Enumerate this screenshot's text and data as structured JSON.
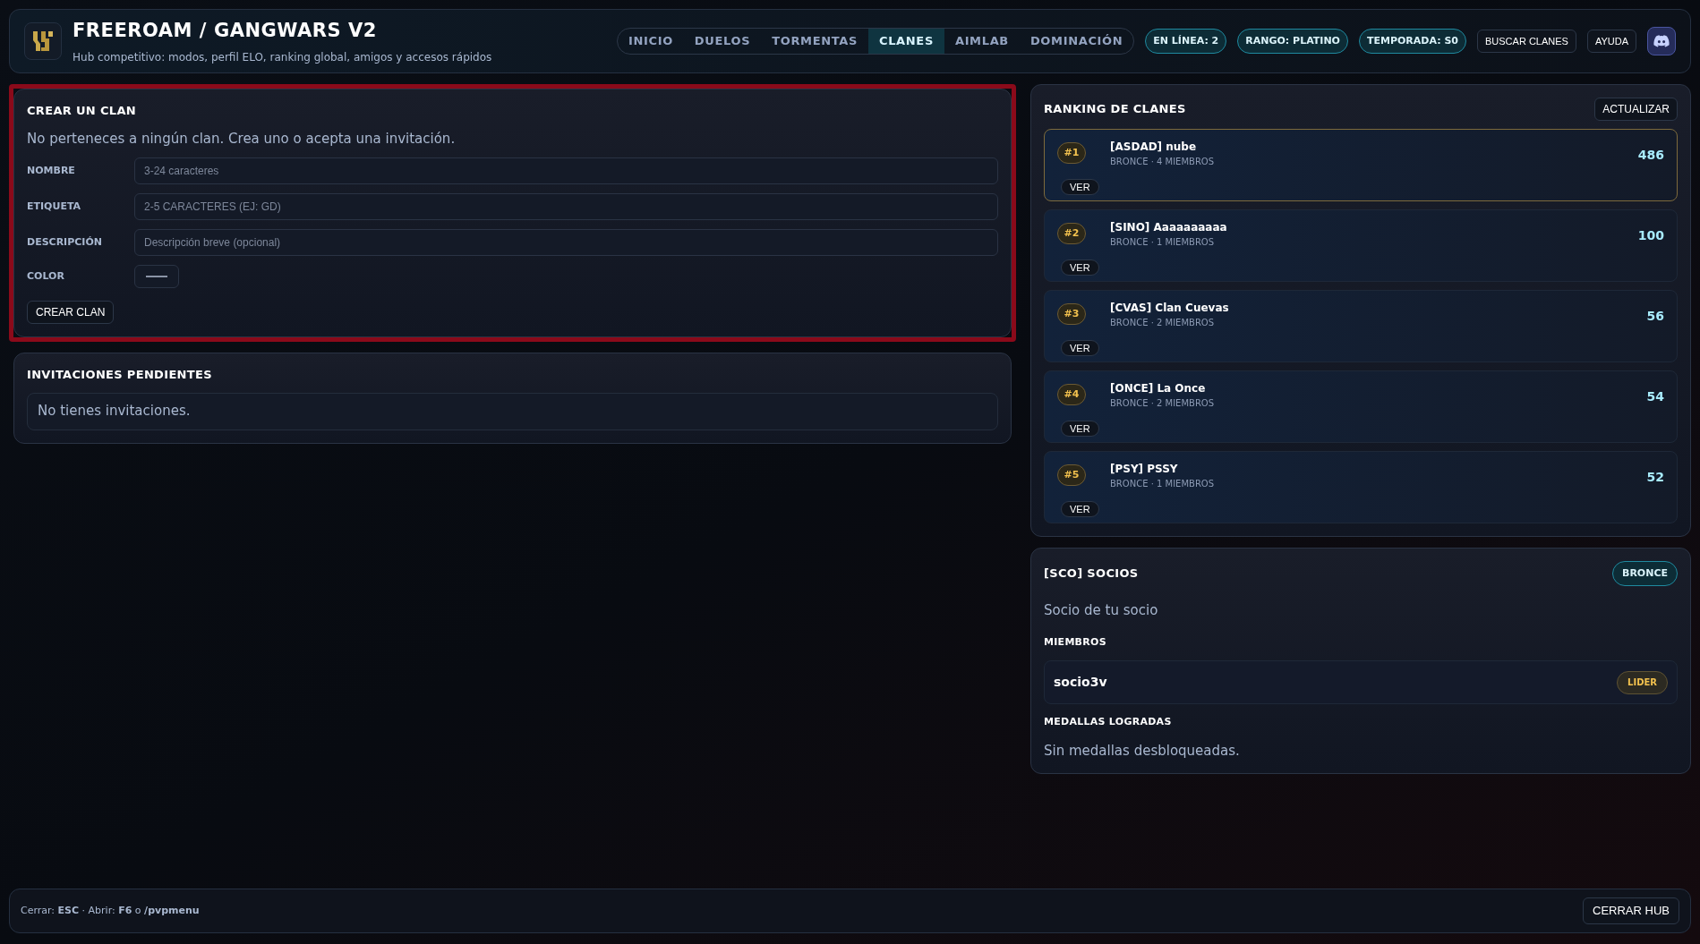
{
  "header": {
    "title": "FREEROAM / GANGWARS V2",
    "subtitle": "Hub competitivo: modos, perfil ELO, ranking global, amigos y accesos rápidos",
    "tabs": [
      {
        "label": "INICIO",
        "selected": false
      },
      {
        "label": "DUELOS",
        "selected": false
      },
      {
        "label": "TORMENTAS",
        "selected": false
      },
      {
        "label": "CLANES",
        "selected": true
      },
      {
        "label": "AIMLAB",
        "selected": false
      },
      {
        "label": "DOMINACIÓN",
        "selected": false
      }
    ],
    "badges": [
      "EN LÍNEA: 2",
      "RANGO: PLATINO",
      "TEMPORADA: S0"
    ],
    "buttons": [
      "BUSCAR CLANES",
      "AYUDA"
    ]
  },
  "create_clan": {
    "title": "CREAR UN CLAN",
    "highlighted": true,
    "message": "No perteneces a ningún clan. Crea uno o acepta una invitación.",
    "fields": [
      {
        "kind": "text",
        "label": "NOMBRE",
        "placeholder": "3-24 caracteres"
      },
      {
        "kind": "text",
        "label": "ETIQUETA",
        "placeholder": "2-5 CARACTERES (EJ: GD)"
      },
      {
        "kind": "text",
        "label": "DESCRIPCIÓN",
        "placeholder": "Descripción breve (opcional)"
      },
      {
        "kind": "color",
        "label": "COLOR"
      }
    ],
    "submit": "CREAR CLAN"
  },
  "invitations": {
    "title": "INVITACIONES PENDIENTES",
    "empty_text": "No tienes invitaciones."
  },
  "ranking": {
    "title": "RANKING DE CLANES",
    "refresh": "ACTUALIZAR",
    "rows": [
      {
        "rank": "#1",
        "name": "[ASDAD] nube",
        "meta": "BRONCE · 4 MIEMBROS",
        "score": "486",
        "selected": true,
        "action": "VER"
      },
      {
        "rank": "#2",
        "name": "[SINO] Aaaaaaaaaa",
        "meta": "BRONCE · 1 MIEMBROS",
        "score": "100",
        "selected": false,
        "action": "VER"
      },
      {
        "rank": "#3",
        "name": "[CVAS] Clan Cuevas",
        "meta": "BRONCE · 2 MIEMBROS",
        "score": "56",
        "selected": false,
        "action": "VER"
      },
      {
        "rank": "#4",
        "name": "[ONCE] La Once",
        "meta": "BRONCE · 2 MIEMBROS",
        "score": "54",
        "selected": false,
        "action": "VER"
      },
      {
        "rank": "#5",
        "name": "[PSY] PSSY",
        "meta": "BRONCE · 1 MIEMBROS",
        "score": "52",
        "selected": false,
        "action": "VER"
      }
    ]
  },
  "clan_detail": {
    "title": "[SCO] SOCIOS",
    "tier": "BRONCE",
    "description": "Socio de tu socio",
    "members_title": "MIEMBROS",
    "members": [
      {
        "name": "socio3v",
        "role": "LIDER"
      }
    ],
    "medals_title": "MEDALLAS LOGRADAS",
    "medals_empty": "Sin medallas desbloqueadas."
  },
  "footer": {
    "hint": "Cerrar: **ESC** · Abrir: **F6** o **/pvpmenu**",
    "close": "CERRAR HUB"
  }
}
